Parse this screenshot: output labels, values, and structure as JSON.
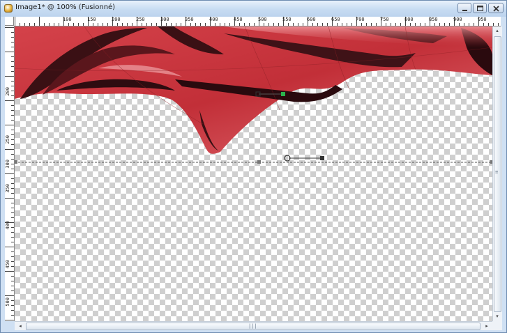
{
  "window": {
    "title": "Image1* @ 100% (Fusionné)",
    "icon": "paint-shop-pro-document-icon",
    "buttons": {
      "minimize": "minimize-icon",
      "maximize": "maximize-icon",
      "close": "close-icon"
    }
  },
  "rulers": {
    "top_labels": [
      "100",
      "150",
      "200",
      "250",
      "300",
      "350",
      "400",
      "450",
      "500",
      "550",
      "600",
      "650",
      "700",
      "750",
      "800",
      "850",
      "900",
      "950"
    ],
    "left_labels": [
      "200",
      "250",
      "300",
      "350",
      "400",
      "450",
      "500"
    ]
  },
  "canvas": {
    "background": "transparency-checkerboard",
    "artwork": "red-fractal-curved-shape",
    "accent_color": "#c9363d",
    "dark_color": "#3a1014"
  },
  "scrollbars": {
    "left_arrow": "◂",
    "right_arrow": "▸",
    "up_arrow": "▴",
    "down_arrow": "▾",
    "grip": "|||"
  }
}
